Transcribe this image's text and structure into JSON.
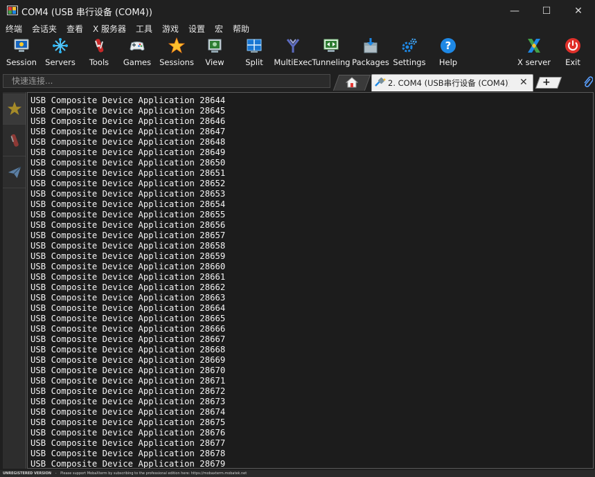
{
  "window": {
    "title": "COM4  (USB 串行设备 (COM4))",
    "minimize_glyph": "—",
    "maximize_glyph": "☐",
    "close_glyph": "✕"
  },
  "menu": [
    "终端",
    "会话夹",
    "查看",
    "X 服务器",
    "工具",
    "游戏",
    "设置",
    "宏",
    "帮助"
  ],
  "toolbar": {
    "session": "Session",
    "servers": "Servers",
    "tools": "Tools",
    "games": "Games",
    "sessions": "Sessions",
    "view": "View",
    "split": "Split",
    "multiexec": "MultiExec",
    "tunneling": "Tunneling",
    "packages": "Packages",
    "settings": "Settings",
    "help": "Help",
    "xserver": "X server",
    "exit": "Exit"
  },
  "quick_connect": {
    "placeholder": "快速连接..."
  },
  "tabs": {
    "active_label": "2. COM4  (USB串行设备 (COM4))",
    "close_glyph": "✕",
    "new_glyph": "+"
  },
  "terminal": {
    "lines": [
      "USB Composite Device Application 28644",
      "USB Composite Device Application 28645",
      "USB Composite Device Application 28646",
      "USB Composite Device Application 28647",
      "USB Composite Device Application 28648",
      "USB Composite Device Application 28649",
      "USB Composite Device Application 28650",
      "USB Composite Device Application 28651",
      "USB Composite Device Application 28652",
      "USB Composite Device Application 28653",
      "USB Composite Device Application 28654",
      "USB Composite Device Application 28655",
      "USB Composite Device Application 28656",
      "USB Composite Device Application 28657",
      "USB Composite Device Application 28658",
      "USB Composite Device Application 28659",
      "USB Composite Device Application 28660",
      "USB Composite Device Application 28661",
      "USB Composite Device Application 28662",
      "USB Composite Device Application 28663",
      "USB Composite Device Application 28664",
      "USB Composite Device Application 28665",
      "USB Composite Device Application 28666",
      "USB Composite Device Application 28667",
      "USB Composite Device Application 28668",
      "USB Composite Device Application 28669",
      "USB Composite Device Application 28670",
      "USB Composite Device Application 28671",
      "USB Composite Device Application 28672",
      "USB Composite Device Application 28673",
      "USB Composite Device Application 28674",
      "USB Composite Device Application 28675",
      "USB Composite Device Application 28676",
      "USB Composite Device Application 28677",
      "USB Composite Device Application 28678",
      "USB Composite Device Application 28679"
    ]
  },
  "statusbar": {
    "version": "UNREGISTERED VERSION",
    "separator": "-",
    "message": "Please support MobaXterm by subscribing to the professional edition here:",
    "link": "https://mobaxterm.mobatek.net"
  },
  "colors": {
    "background": "#1f1f1f",
    "terminal_bg": "#1c1c1c",
    "terminal_text": "#f4f4f4",
    "exit_red": "#e0302a",
    "help_blue": "#1e88e5"
  }
}
